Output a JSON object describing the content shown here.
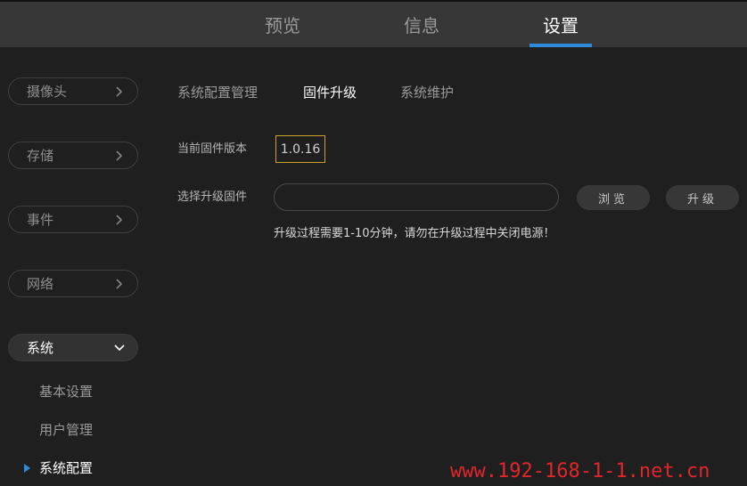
{
  "top_nav": {
    "preview": "预览",
    "info": "信息",
    "settings": "设置",
    "active": "settings",
    "accent_color": "#2f8bd9"
  },
  "sidebar": {
    "camera": "摄像头",
    "storage": "存储",
    "event": "事件",
    "network": "网络",
    "system": "系统",
    "sub_items": {
      "basic_settings": "基本设置",
      "user_management": "用户管理",
      "system_config": "系统配置"
    },
    "icons": {
      "collapsed": "chevron-right-icon",
      "expanded": "chevron-down-icon",
      "active_marker": "triangle-right-icon"
    }
  },
  "content": {
    "tabs": {
      "config_management": "系统配置管理",
      "firmware_upgrade": "固件升级",
      "maintenance": "系统维护"
    },
    "current_version_label": "当前固件版本",
    "current_version": "1.0.16",
    "select_firmware_label": "选择升级固件",
    "file_value": "",
    "browse_label": "浏览",
    "upgrade_label": "升级",
    "warning": "升级过程需要1-10分钟，请勿在升级过程中关闭电源！"
  },
  "watermark": "www.192-168-1-1.net.cn"
}
